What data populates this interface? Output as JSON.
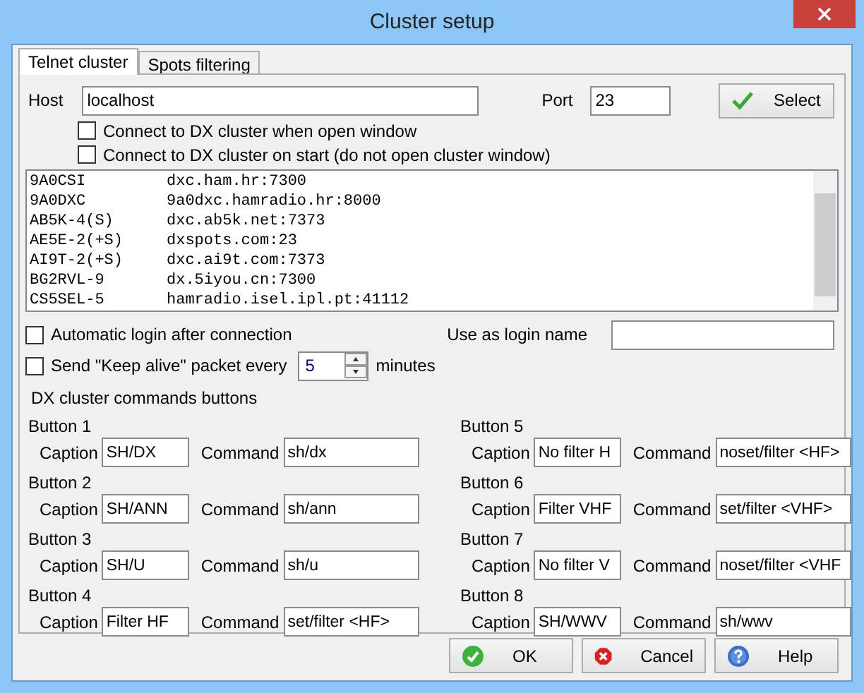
{
  "window": {
    "title": "Cluster setup"
  },
  "tabs": [
    {
      "label": "Telnet cluster",
      "selected": true
    },
    {
      "label": "Spots filtering",
      "selected": false
    }
  ],
  "host": {
    "label": "Host",
    "value": "localhost"
  },
  "port": {
    "label": "Port",
    "value": "23"
  },
  "select_button": {
    "label": "Select"
  },
  "connect_options": [
    {
      "label": "Connect to DX cluster when open window",
      "checked": false
    },
    {
      "label": "Connect to DX cluster on start (do not open cluster window)",
      "checked": false
    }
  ],
  "clusters": [
    {
      "callsign": "9A0CSI",
      "address": "dxc.ham.hr:7300"
    },
    {
      "callsign": "9A0DXC",
      "address": "9a0dxc.hamradio.hr:8000"
    },
    {
      "callsign": "AB5K-4(S)",
      "address": "dxc.ab5k.net:7373"
    },
    {
      "callsign": "AE5E-2(+S)",
      "address": "dxspots.com:23"
    },
    {
      "callsign": "AI9T-2(+S)",
      "address": "dxc.ai9t.com:7373"
    },
    {
      "callsign": "BG2RVL-9",
      "address": "dx.5iyou.cn:7300"
    },
    {
      "callsign": "CS5SEL-5",
      "address": "hamradio.isel.ipl.pt:41112"
    }
  ],
  "auto_login": {
    "label": "Automatic login after connection",
    "checked": false
  },
  "login_name": {
    "label": "Use as login name"
  },
  "keep_alive": {
    "label": "Send \"Keep alive\" packet every",
    "checked": false,
    "value": "5",
    "unit": "minutes"
  },
  "commands_heading": "DX cluster commands buttons",
  "command_buttons": [
    {
      "title": "Button 1",
      "caption_label": "Caption",
      "caption": "SH/DX",
      "command_label": "Command",
      "command": "sh/dx"
    },
    {
      "title": "Button 2",
      "caption_label": "Caption",
      "caption": "SH/ANN",
      "command_label": "Command",
      "command": "sh/ann"
    },
    {
      "title": "Button 3",
      "caption_label": "Caption",
      "caption": "SH/U",
      "command_label": "Command",
      "command": "sh/u"
    },
    {
      "title": "Button 4",
      "caption_label": "Caption",
      "caption": "Filter HF",
      "command_label": "Command",
      "command": "set/filter <HF>"
    },
    {
      "title": "Button 5",
      "caption_label": "Caption",
      "caption": "No filter H",
      "command_label": "Command",
      "command": "noset/filter <HF>"
    },
    {
      "title": "Button 6",
      "caption_label": "Caption",
      "caption": "Filter VHF",
      "command_label": "Command",
      "command": "set/filter <VHF>"
    },
    {
      "title": "Button 7",
      "caption_label": "Caption",
      "caption": "No filter V",
      "command_label": "Command",
      "command": "noset/filter <VHF"
    },
    {
      "title": "Button 8",
      "caption_label": "Caption",
      "caption": "SH/WWV",
      "command_label": "Command",
      "command": "sh/wwv"
    }
  ],
  "footer_buttons": [
    {
      "kind": "ok",
      "label": "OK"
    },
    {
      "kind": "cancel",
      "label": "Cancel"
    },
    {
      "kind": "help",
      "label": "Help"
    }
  ]
}
